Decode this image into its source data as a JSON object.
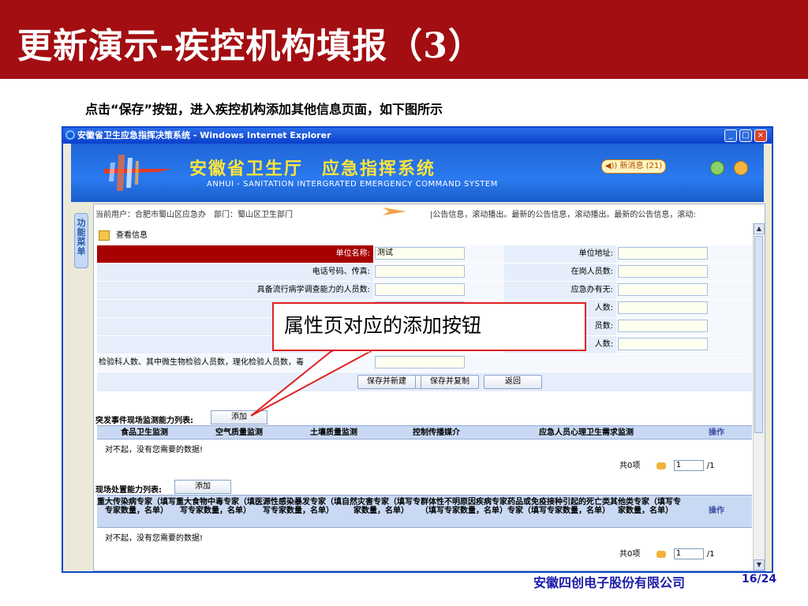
{
  "slide": {
    "title": "更新演示-疾控机构填报（3）",
    "subtitle": "点击“保存”按钮，进入疾控机构添加其他信息页面，如下图所示",
    "company": "安徽四创电子股份有限公司",
    "page": "16/24",
    "callout": "属性页对应的添加按钮"
  },
  "window": {
    "title": "安徽省卫生应急指挥决策系统 - Windows Internet Explorer",
    "minimize": "_",
    "maximize": "□",
    "close": "×"
  },
  "header": {
    "app_name": "安徽省卫生厅　应急指挥系统",
    "app_en": "ANHUI - SANITATION INTERGRATED EMERGENCY COMMAND SYSTEM",
    "news": "◀)) 新消息 (21)"
  },
  "sidebar": {
    "tab": "功能菜单"
  },
  "status": {
    "user": "当前用户：合肥市蜀山区应急办　部门：蜀山区卫生部门",
    "marquee": "|公告信息，滚动播出。最新的公告信息，滚动播出。最新的公告信息，滚动:"
  },
  "view": {
    "title": "查看信息"
  },
  "form": {
    "rows": [
      {
        "left_label": "单位名称:",
        "left_value": "测试",
        "right_label": "单位地址:",
        "right_value": ""
      },
      {
        "left_label": "电话号码、传真:",
        "left_value": "",
        "right_label": "在岗人员数:",
        "right_value": ""
      },
      {
        "left_label": "具备流行病学调查能力的人员数:",
        "left_value": "",
        "right_label": "应急办有无:",
        "right_value": ""
      },
      {
        "left_label": "",
        "left_value": "",
        "right_label": "人数:",
        "right_value": ""
      },
      {
        "left_label": "",
        "left_value": "",
        "right_label": "员数:",
        "right_value": ""
      },
      {
        "left_label": "",
        "left_value": "",
        "right_label": "人数:",
        "right_value": ""
      },
      {
        "left_label": "检验科人数、其中微生物检验人员数，理化检验人员数，毒",
        "left_value": "",
        "right_label": "",
        "right_value": ""
      }
    ],
    "buttons": [
      "保存并新建",
      "保存并复制",
      "返回"
    ]
  },
  "grid1": {
    "label": "突发事件现场监测能力列表:",
    "add": "添加",
    "columns": [
      "食品卫生监测",
      "空气质量监测",
      "土壤质量监测",
      "控制传播媒介",
      "应急人员心理卫生需求监测",
      "操作"
    ],
    "empty": "对不起，没有您需要的数据!",
    "pager_total": "共0项",
    "pager_page": "1",
    "pager_of": "/1"
  },
  "grid2": {
    "label": "现场处置能力列表:",
    "add": "添加",
    "columns": [
      "重大传染病专家（填写专家数量，名单）",
      "重大食物中毒专家（填写专家数量，名单）",
      "医源性感染暴发专家（填写专家数量，名单）",
      "自然灾害专家（填写专家数量，名单）",
      "群体性不明原因疾病专家（填写专家数量，名单）",
      "药品或免疫接种引起的死亡类专家（填写专家数量，名单）",
      "其他类专家（填写专家数量，名单）",
      "操作"
    ],
    "empty": "对不起，没有您需要的数据!",
    "pager_total": "共0项",
    "pager_page": "1",
    "pager_of": "/1"
  },
  "colors": {
    "title_bar": "#a30e12",
    "window_border": "#0b47c8",
    "header_blue": "#2b7af0",
    "app_name": "#ffe43a",
    "footer_text": "#1a1aa8",
    "callout_border": "#e02020"
  }
}
